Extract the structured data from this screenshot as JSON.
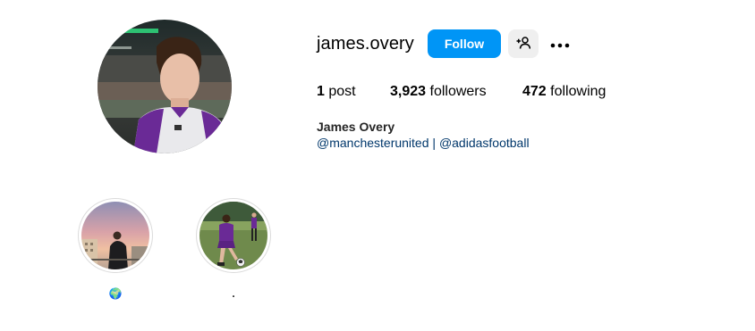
{
  "profile": {
    "username": "james.overy",
    "full_name": "James Overy",
    "follow_label": "Follow",
    "suggest_icon": "person-plus-icon",
    "more_icon": "more-horizontal-icon",
    "avatar_icon": "profile-photo"
  },
  "stats": {
    "posts_count": "1",
    "posts_label": "post",
    "followers_count": "3,923",
    "followers_label": "followers",
    "following_count": "472",
    "following_label": "following"
  },
  "bio": {
    "link_1": "@manchesterunited",
    "separator": "|",
    "link_2": "@adidasfootball"
  },
  "highlights": [
    {
      "label": "🌍",
      "image": "sunset-balcony-photo"
    },
    {
      "label": ".",
      "image": "football-training-photo"
    }
  ],
  "colors": {
    "follow_blue": "#0095f6",
    "link_blue": "#00376b",
    "secondary_button_bg": "#efefef",
    "highlight_border": "#dbdbdb",
    "kit_purple": "#6a2a96"
  }
}
